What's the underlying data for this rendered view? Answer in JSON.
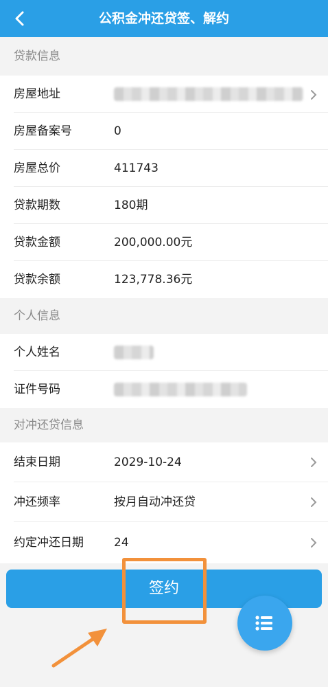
{
  "header": {
    "title": "公积金冲还贷签、解约"
  },
  "sections": {
    "loan_info": "贷款信息",
    "personal_info": "个人信息",
    "offset_info": "对冲还贷信息"
  },
  "loan": {
    "address_label": "房屋地址",
    "record_no_label": "房屋备案号",
    "record_no_value": "0",
    "total_price_label": "房屋总价",
    "total_price_value": "411743",
    "periods_label": "贷款期数",
    "periods_value": "180期",
    "amount_label": "贷款金额",
    "amount_value": "200,000.00元",
    "balance_label": "贷款余额",
    "balance_value": "123,778.36元"
  },
  "personal": {
    "name_label": "个人姓名",
    "id_label": "证件号码"
  },
  "offset": {
    "end_date_label": "结束日期",
    "end_date_value": "2029-10-24",
    "frequency_label": "冲还频率",
    "frequency_value": "按月自动冲还贷",
    "agreed_day_label": "约定冲还日期",
    "agreed_day_value": "24"
  },
  "actions": {
    "sign_label": "签约"
  },
  "icons": {
    "back": "chevron-left-icon",
    "row_arrow": "chevron-right-icon",
    "fab": "list-icon"
  },
  "colors": {
    "primary": "#2a9fe6",
    "highlight": "#f2913b"
  }
}
